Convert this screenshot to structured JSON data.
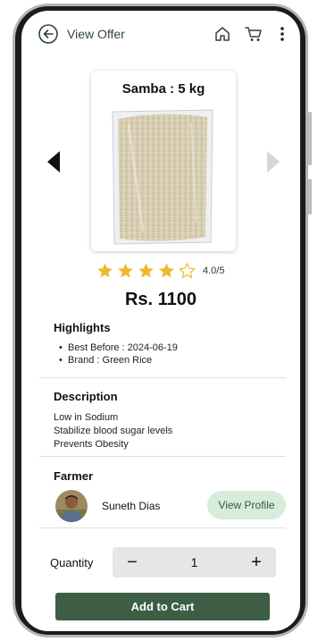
{
  "header": {
    "title": "View Offer",
    "icons": [
      "back-arrow-icon",
      "home-icon",
      "cart-icon",
      "more-vertical-icon"
    ]
  },
  "product": {
    "name": "Samba : 5 kg",
    "image": "rice-bag-image",
    "rating": {
      "stars": 4,
      "max": 5,
      "text": "4.0/5"
    },
    "price": "Rs. 1100"
  },
  "highlights": {
    "title": "Highlights",
    "items": [
      "Best Before : 2024-06-19",
      "Brand : Green Rice"
    ]
  },
  "description": {
    "title": "Description",
    "lines": [
      "Low in Sodium",
      "Stabilize blood sugar levels",
      "Prevents Obesity"
    ]
  },
  "farmer": {
    "title": "Farmer",
    "name": "Suneth Dias",
    "profile_button": "View Profile"
  },
  "quantity": {
    "label": "Quantity",
    "minus": "−",
    "value": "1",
    "plus": "+"
  },
  "cart_button": "Add to Cart",
  "colors": {
    "accent": "#3d5e45",
    "profile_button_bg": "#d8ecdc",
    "star": "#f2b730"
  }
}
